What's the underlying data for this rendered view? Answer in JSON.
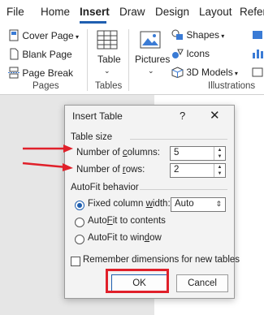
{
  "ribbon": {
    "tabs": [
      {
        "label": "File"
      },
      {
        "label": "Home"
      },
      {
        "label": "Insert"
      },
      {
        "label": "Draw"
      },
      {
        "label": "Design"
      },
      {
        "label": "Layout"
      },
      {
        "label": "Refer"
      }
    ],
    "active_tab": "Insert",
    "pages_group": {
      "label": "Pages",
      "cover_page": "Cover Page",
      "blank_page": "Blank Page",
      "page_break": "Page Break"
    },
    "tables_group": {
      "label": "Tables",
      "table": "Table"
    },
    "illustrations_group": {
      "label": "Illustrations",
      "pictures": "Pictures",
      "shapes": "Shapes",
      "icons": "Icons",
      "models": "3D Models"
    }
  },
  "dialog": {
    "title": "Insert Table",
    "help": "?",
    "close": "✕",
    "table_size": {
      "label": "Table size",
      "columns_label": "Number of columns:",
      "columns_value": "5",
      "rows_label": "Number of rows:",
      "rows_value": "2"
    },
    "autofit": {
      "label": "AutoFit behavior",
      "fixed_label": "Fixed column width:",
      "fixed_value": "Auto",
      "contents_label": "AutoFit to contents",
      "window_label": "AutoFit to window",
      "selected": "fixed"
    },
    "remember_label": "Remember dimensions for new tables",
    "ok": "OK",
    "cancel": "Cancel"
  },
  "colors": {
    "accent": "#1f5fb0",
    "annotation_red": "#e0202a"
  }
}
